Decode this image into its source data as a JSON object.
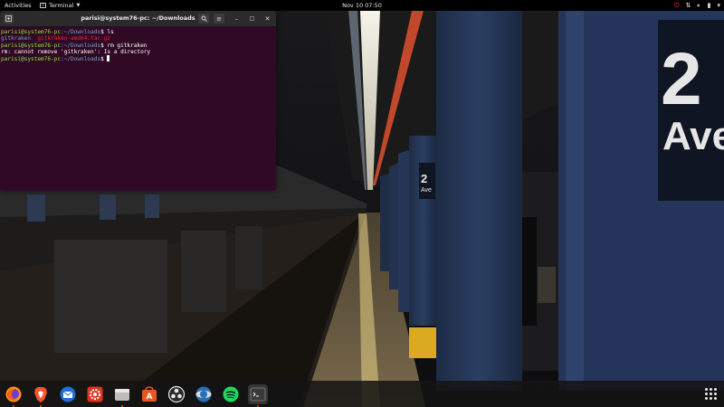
{
  "topbar": {
    "activities_label": "Activities",
    "app_menu_label": "Terminal",
    "clock": "Nov 10  07:50",
    "tray": [
      "power-icon",
      "network-icon",
      "volume-icon",
      "battery-icon",
      "system-menu-icon"
    ]
  },
  "terminal": {
    "title": "parisi@system76-pc: ~/Downloads",
    "lines": [
      {
        "user": "parisi@system76-pc",
        "path": ":~/Downloads",
        "cmd": "$ ls"
      },
      {
        "dir": "gitkraken",
        "archive": "gitkraken-amd64.tar.gz"
      },
      {
        "user": "parisi@system76-pc",
        "path": ":~/Downloads",
        "cmd": "$ rm gitkraken"
      },
      {
        "output": "rm: cannot remove 'gitkraken': Is a directory"
      },
      {
        "user": "parisi@system76-pc",
        "path": ":~/Downloads",
        "cmd": "$ "
      }
    ],
    "colors": {
      "background": "#300a24",
      "user": "#8ae234",
      "path": "#729fcf",
      "archive": "#ef2929"
    }
  },
  "dock": {
    "apps": [
      "firefox-icon",
      "brave-icon",
      "mail-icon",
      "settings-gear-icon",
      "files-icon",
      "software-store-icon",
      "obs-icon",
      "globe-icon",
      "spotify-icon",
      "terminal-icon"
    ],
    "running": [
      "firefox-icon",
      "brave-icon",
      "files-icon",
      "terminal-icon"
    ]
  },
  "wallpaper": {
    "sign_number": "2",
    "sign_text": "Ave",
    "small_sign_number": "2",
    "small_sign_text": "Ave"
  }
}
